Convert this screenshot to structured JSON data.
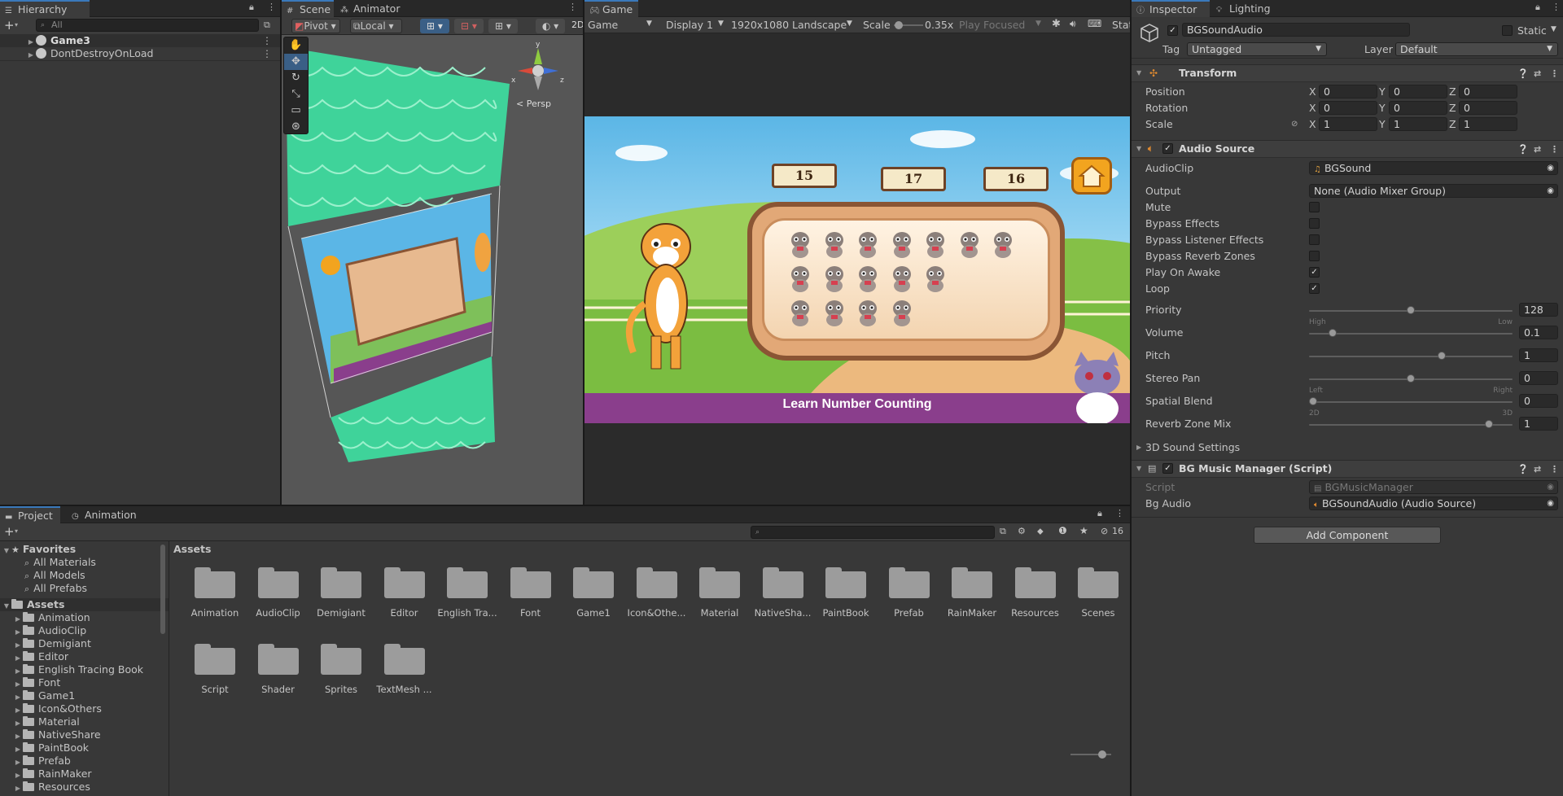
{
  "hierarchy": {
    "tab_label": "Hierarchy",
    "search_placeholder": "All",
    "items": [
      {
        "label": "Game3"
      },
      {
        "label": "DontDestroyOnLoad"
      }
    ]
  },
  "scene": {
    "tabs": [
      {
        "label": "Scene"
      },
      {
        "label": "Animator"
      }
    ],
    "toolbar": {
      "pivot": "Pivot",
      "local": "Local",
      "mode_2d": "2D"
    },
    "persp_label": "< Persp"
  },
  "game": {
    "tab_label": "Game",
    "toolbar": {
      "view": "Game",
      "display": "Display 1",
      "resolution": "1920x1080 Landscape",
      "scale_label": "Scale",
      "scale_value": "0.35x",
      "play_focused": "Play Focused",
      "stats": "Stats"
    },
    "scale_level": 0.05,
    "screen": {
      "numbers": [
        "15",
        "17",
        "16"
      ],
      "banner": "Learn Number Counting",
      "critter_rows": [
        7,
        5,
        4
      ]
    }
  },
  "inspector": {
    "tabs": [
      {
        "label": "Inspector"
      },
      {
        "label": "Lighting"
      }
    ],
    "object_name": "BGSoundAudio",
    "static_label": "Static",
    "tag_label": "Tag",
    "tag_value": "Untagged",
    "layer_label": "Layer",
    "layer_value": "Default",
    "transform": {
      "title": "Transform",
      "rows": [
        {
          "label": "Position",
          "x": "0",
          "y": "0",
          "z": "0"
        },
        {
          "label": "Rotation",
          "x": "0",
          "y": "0",
          "z": "0"
        },
        {
          "label": "Scale",
          "x": "1",
          "y": "1",
          "z": "1"
        }
      ]
    },
    "audio_source": {
      "title": "Audio Source",
      "audio_clip_label": "AudioClip",
      "audio_clip_value": "BGSound",
      "output_label": "Output",
      "output_value": "None (Audio Mixer Group)",
      "toggles": [
        {
          "label": "Mute",
          "checked": false
        },
        {
          "label": "Bypass Effects",
          "checked": false
        },
        {
          "label": "Bypass Listener Effects",
          "checked": false
        },
        {
          "label": "Bypass Reverb Zones",
          "checked": false
        },
        {
          "label": "Play On Awake",
          "checked": true
        },
        {
          "label": "Loop",
          "checked": true
        }
      ],
      "sliders": [
        {
          "label": "Priority",
          "value": "128",
          "level": 0.5,
          "left": "High",
          "right": "Low"
        },
        {
          "label": "Volume",
          "value": "0.1",
          "level": 0.1,
          "left": "",
          "right": ""
        },
        {
          "label": "Pitch",
          "value": "1",
          "level": 0.66,
          "left": "",
          "right": ""
        },
        {
          "label": "Stereo Pan",
          "value": "0",
          "level": 0.5,
          "left": "Left",
          "right": "Right"
        },
        {
          "label": "Spatial Blend",
          "value": "0",
          "level": 0.0,
          "left": "2D",
          "right": "3D"
        },
        {
          "label": "Reverb Zone Mix",
          "value": "1",
          "level": 0.9,
          "left": "",
          "right": ""
        }
      ],
      "sound_3d_label": "3D Sound Settings"
    },
    "script_component": {
      "title": "BG Music Manager (Script)",
      "script_label": "Script",
      "script_value": "BGMusicManager",
      "bg_audio_label": "Bg Audio",
      "bg_audio_value": "BGSoundAudio (Audio Source)"
    },
    "add_component": "Add Component"
  },
  "project": {
    "tabs": [
      {
        "label": "Project"
      },
      {
        "label": "Animation"
      }
    ],
    "hidden_count": "16",
    "breadcrumb": "Assets",
    "favorites_label": "Favorites",
    "favorites": [
      {
        "label": "All Materials"
      },
      {
        "label": "All Models"
      },
      {
        "label": "All Prefabs"
      }
    ],
    "assets_label": "Assets",
    "tree_folders": [
      {
        "label": "Animation"
      },
      {
        "label": "AudioClip"
      },
      {
        "label": "Demigiant"
      },
      {
        "label": "Editor"
      },
      {
        "label": "English Tracing Book"
      },
      {
        "label": "Font"
      },
      {
        "label": "Game1"
      },
      {
        "label": "Icon&Others"
      },
      {
        "label": "Material"
      },
      {
        "label": "NativeShare"
      },
      {
        "label": "PaintBook"
      },
      {
        "label": "Prefab"
      },
      {
        "label": "RainMaker"
      },
      {
        "label": "Resources"
      }
    ],
    "grid_folders": [
      {
        "label": "Animation"
      },
      {
        "label": "AudioClip"
      },
      {
        "label": "Demigiant"
      },
      {
        "label": "Editor"
      },
      {
        "label": "English Tra..."
      },
      {
        "label": "Font"
      },
      {
        "label": "Game1"
      },
      {
        "label": "Icon&Othe..."
      },
      {
        "label": "Material"
      },
      {
        "label": "NativeSha..."
      },
      {
        "label": "PaintBook"
      },
      {
        "label": "Prefab"
      },
      {
        "label": "RainMaker"
      },
      {
        "label": "Resources"
      },
      {
        "label": "Scenes"
      },
      {
        "label": "Script"
      },
      {
        "label": "Shader"
      },
      {
        "label": "Sprites"
      },
      {
        "label": "TextMesh ..."
      }
    ]
  },
  "colors": {
    "accent": "#3a79bb",
    "panel": "#383838",
    "field": "#2a2a2a",
    "banner": "#8a3e8c",
    "sky": "#5bb6e6"
  }
}
